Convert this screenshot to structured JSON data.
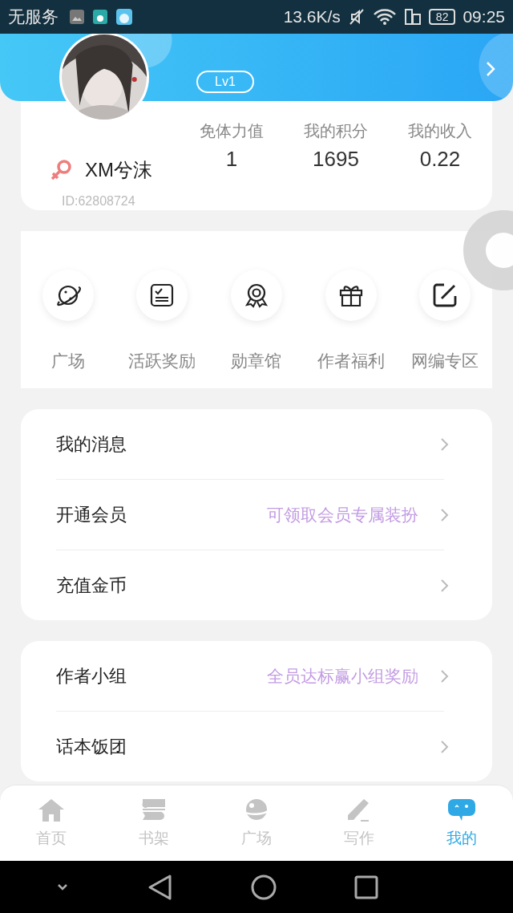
{
  "status_bar": {
    "carrier": "无服务",
    "speed": "13.6K/s",
    "battery": "82",
    "time": "09:25"
  },
  "profile": {
    "level": "Lv1",
    "name": "XM兮沫",
    "id": "ID:62808724",
    "stats": [
      {
        "label": "免体力值",
        "value": "1"
      },
      {
        "label": "我的积分",
        "value": "1695"
      },
      {
        "label": "我的收入",
        "value": "0.22"
      }
    ]
  },
  "shortcuts": [
    {
      "label": "广场"
    },
    {
      "label": "活跃奖励"
    },
    {
      "label": "勋章馆"
    },
    {
      "label": "作者福利"
    },
    {
      "label": "网编专区"
    }
  ],
  "menu_groups": [
    [
      {
        "label": "我的消息"
      },
      {
        "label": "开通会员",
        "hint": "可领取会员专属装扮"
      },
      {
        "label": "充值金币"
      }
    ],
    [
      {
        "label": "作者小组",
        "hint": "全员达标赢小组奖励"
      },
      {
        "label": "话本饭团"
      }
    ]
  ],
  "tab_bar": [
    {
      "label": "首页",
      "selected": false
    },
    {
      "label": "书架",
      "selected": false
    },
    {
      "label": "广场",
      "selected": false
    },
    {
      "label": "写作",
      "selected": false
    },
    {
      "label": "我的",
      "selected": true
    }
  ]
}
